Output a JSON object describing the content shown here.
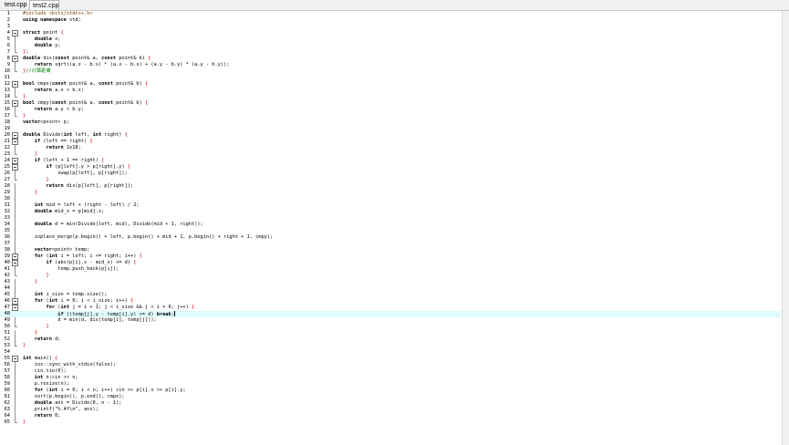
{
  "tabs": [
    {
      "label": "test.cpp",
      "active": false
    },
    {
      "label": "test2.cpp",
      "active": true
    }
  ],
  "editor": {
    "highlight_line": 48,
    "lines": [
      "#include <bits/stdc++.h>",
      "using namespace std;",
      "",
      "struct point {",
      "    double x;",
      "    double y;",
      "};",
      "double dis(const point& a, const point& b) {",
      "    return sqrt((a.x - b.x) * (a.x - b.x) + (a.y - b.y) * (a.y - b.y));",
      "}//计算距离",
      "",
      "bool cmpx(const point& a, const point& b) {",
      "    return a.x < b.x;",
      "}",
      "bool cmpy(const point& a, const point& b) {",
      "    return a.y < b.y;",
      "}",
      "vector<point> p;",
      "",
      "double Divide(int left, int right) {",
      "    if (left == right) {",
      "        return 1e18;",
      "    }",
      "    if (left + 1 == right) {",
      "        if (p[left].y > p[right].y) {",
      "            swap(p[left], p[right]);",
      "        }",
      "        return dis(p[left], p[right]);",
      "    }",
      "",
      "    int mid = left + (right - left) / 2;",
      "    double mid_x = p[mid].x;",
      "",
      "    double d = min(Divide(left, mid), Divide(mid + 1, right));",
      "",
      "    inplace_merge(p.begin() + left, p.begin() + mid + 1, p.begin() + right + 1, cmpy);",
      "",
      "    vector<point> temp;",
      "    for (int i = left; i <= right; i++) {",
      "        if (abs(p[i].x - mid_x) <= d) {",
      "            temp.push_back(p[i]);",
      "        }",
      "    }",
      "",
      "    int i_size = temp.size();",
      "    for (int i = 0; i < i_size; i++) {",
      "        for (int j = i + 1; j < i_size && j < i + 6; j++) {",
      "            if ((temp[j].y - temp[i].y) >= d) break;",
      "            d = min(d, dis(temp[i], temp[j]));",
      "        }",
      "    }",
      "    return d;",
      "}",
      "",
      "int main() {",
      "    ios::sync_with_stdio(false);",
      "    cin.tie(0);",
      "    int n;cin >> n;",
      "    p.resize(n);",
      "    for (int i = 0; i < n; i++) cin >> p[i].x >> p[i].y;",
      "    sort(p.begin(), p.end(), cmpx);",
      "    double ans = Divide(0, n - 1);",
      "    printf(\"%.4f\\n\", ans);",
      "    return 0;",
      "}"
    ]
  }
}
